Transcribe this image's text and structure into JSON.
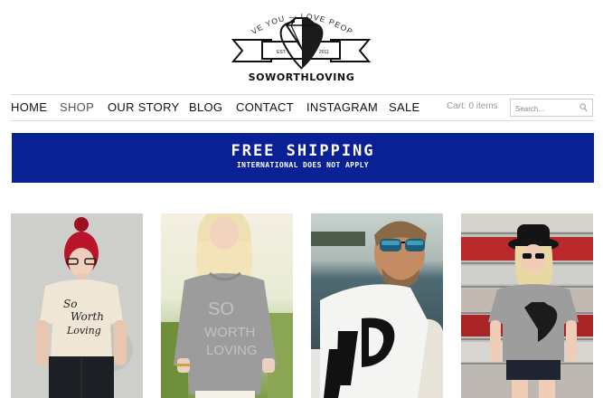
{
  "brand": {
    "tagline": "LOVE YOU — LOVE PEOPLE",
    "est": "EST.",
    "year": "2011",
    "name": "SOWORTHLOVING"
  },
  "nav": {
    "items": [
      {
        "label": "HOME",
        "active": false
      },
      {
        "label": "SHOP",
        "active": true
      },
      {
        "label": "OUR STORY",
        "active": false
      },
      {
        "label": "BLOG",
        "active": false
      },
      {
        "label": "CONTACT",
        "active": false
      },
      {
        "label": "INSTAGRAM",
        "active": false
      },
      {
        "label": "SALE",
        "active": false
      }
    ],
    "cart": "Cart: 0 items",
    "search_placeholder": "Search..."
  },
  "banner": {
    "title": "FREE SHIPPING",
    "subtitle": "INTERNATIONAL DOES NOT APPLY",
    "color": "#0a2196"
  },
  "products": [
    {
      "image": "woman-red-hair-script-tee-photo",
      "shirt_text_1": "So",
      "shirt_text_2": "Worth",
      "shirt_text_3": "Loving"
    },
    {
      "image": "woman-blonde-grey-sweatshirt-photo",
      "shirt_text_1": "SO",
      "shirt_text_2": "WORTH",
      "shirt_text_3": "LOVING"
    },
    {
      "image": "man-sunglasses-white-tee-photo"
    },
    {
      "image": "woman-hat-grey-diamond-tee-photo"
    }
  ]
}
